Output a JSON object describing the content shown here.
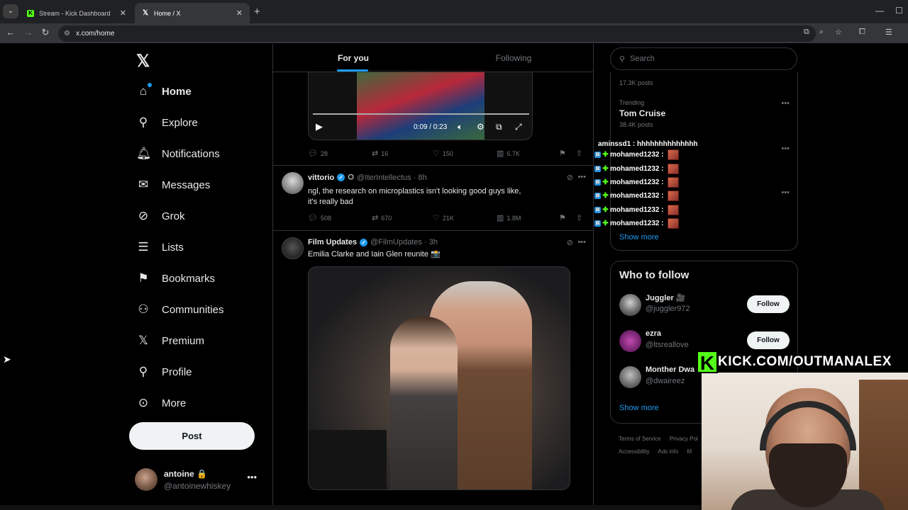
{
  "browser": {
    "tabs": [
      {
        "label": "Stream - Kick Dashboard",
        "favicon": "kick-icon"
      },
      {
        "label": "Home / X",
        "favicon": "x-icon",
        "active": true
      }
    ],
    "url": "x.com/home"
  },
  "leftnav": {
    "items": [
      {
        "label": "Home",
        "icon": "home-icon"
      },
      {
        "label": "Explore",
        "icon": "search-icon"
      },
      {
        "label": "Notifications",
        "icon": "bell-icon"
      },
      {
        "label": "Messages",
        "icon": "mail-icon"
      },
      {
        "label": "Grok",
        "icon": "grok-icon"
      },
      {
        "label": "Lists",
        "icon": "lists-icon"
      },
      {
        "label": "Bookmarks",
        "icon": "bookmark-icon"
      },
      {
        "label": "Communities",
        "icon": "communities-icon"
      },
      {
        "label": "Premium",
        "icon": "x-icon"
      },
      {
        "label": "Profile",
        "icon": "profile-icon"
      },
      {
        "label": "More",
        "icon": "more-circle-icon"
      }
    ],
    "post_label": "Post",
    "account": {
      "name": "antoine 🔒",
      "handle": "@antoinewhiskey"
    }
  },
  "feed": {
    "tabs": [
      "For you",
      "Following"
    ],
    "video": {
      "time": "0:09 / 0:23"
    },
    "video_actions": {
      "replies": "28",
      "reposts": "16",
      "likes": "150",
      "views": "6.7K"
    },
    "tweets": [
      {
        "name": "vittorio",
        "handle": "@IterIntellectus · 8h",
        "text": "ngl, the research on microplastics isn't looking good guys like, it's really bad",
        "actions": {
          "replies": "508",
          "reposts": "670",
          "likes": "21K",
          "views": "1.8M"
        }
      },
      {
        "name": "Film Updates",
        "handle": "@FilmUpdates · 3h",
        "text": "Emilia Clarke and Iain Glen reunite 📸"
      }
    ]
  },
  "right": {
    "search_placeholder": "Search",
    "trends": [
      {
        "category": "",
        "name": "",
        "count": "17.3K posts"
      },
      {
        "category": "Trending",
        "name": "Tom Cruise",
        "count": "38.4K posts"
      }
    ],
    "show_more": "Show more",
    "who_to_follow_title": "Who to follow",
    "who": [
      {
        "name": "Juggler 🎥",
        "handle": "@juggler972",
        "button": "Follow"
      },
      {
        "name": "ezra",
        "handle": "@ltsreallove",
        "button": "Follow"
      },
      {
        "name": "Monther Dwa",
        "handle": "@dwaireez",
        "button": ""
      }
    ],
    "show_more_2": "Show more",
    "footer": [
      "Terms of Service",
      "Privacy Pol",
      "Accessibility",
      "Ads info",
      "M"
    ]
  },
  "stream": {
    "chat_first": "aminssd1 : hhhhhhhhhhhhhh",
    "chat_lines": [
      "mohamed1232 :",
      "mohamed1232 :",
      "mohamed1232 :",
      "mohamed1232 :",
      "mohamed1232 :",
      "mohamed1232 :"
    ],
    "banner": "KICK.COM/OUTMANALEX"
  },
  "colors": {
    "accent": "#1d9bf0",
    "kick_green": "#53fc18",
    "bg": "#000000"
  }
}
